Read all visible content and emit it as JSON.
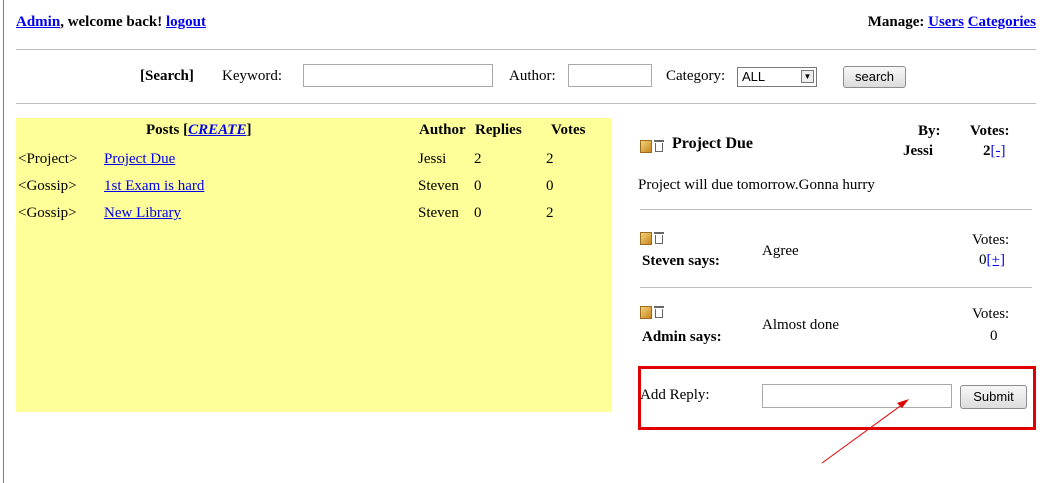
{
  "header": {
    "admin_link": "Admin",
    "welcome_text": ", welcome back!",
    "logout_link": "logout",
    "manage_label": "Manage:",
    "users_link": "Users",
    "categories_link": "Categories"
  },
  "search": {
    "label": "[Search]",
    "keyword_label": "Keyword:",
    "keyword_value": "",
    "author_label": "Author:",
    "author_value": "",
    "category_label": "Category:",
    "category_selected": "ALL",
    "button_label": "search"
  },
  "posts": {
    "title": "Posts",
    "create_link": "CREATE",
    "bracket_open": "[",
    "bracket_close": "]",
    "columns": {
      "author": "Author",
      "replies": "Replies",
      "votes": "Votes"
    },
    "rows": [
      {
        "category": "<Project>",
        "title": "Project Due",
        "author": "Jessi",
        "replies": "2",
        "votes": "2"
      },
      {
        "category": "<Gossip>",
        "title": "1st Exam is hard",
        "author": "Steven",
        "replies": "0",
        "votes": "0"
      },
      {
        "category": "<Gossip>",
        "title": "New Library",
        "author": "Steven",
        "replies": "0",
        "votes": "2"
      }
    ]
  },
  "detail": {
    "post_title": "Project Due",
    "by_label": "By:",
    "by_author": "Jessi",
    "votes_label": "Votes:",
    "votes_value": "2",
    "vote_action": "[-]",
    "body": "Project will due tomorrow.Gonna hurry",
    "replies": [
      {
        "author_says": "Steven says:",
        "text": "Agree",
        "votes_label": "Votes:",
        "votes_value": "0",
        "vote_action": "[+]"
      },
      {
        "author_says": "Admin says:",
        "text": "Almost done",
        "votes_label": "Votes:",
        "votes_value": "0",
        "vote_action": ""
      }
    ],
    "add_reply_label": "Add Reply:",
    "add_reply_value": "",
    "submit_label": "Submit"
  },
  "colors": {
    "posts_bg": "#ffff99",
    "highlight": "#e00000",
    "link": "#0000ee"
  }
}
